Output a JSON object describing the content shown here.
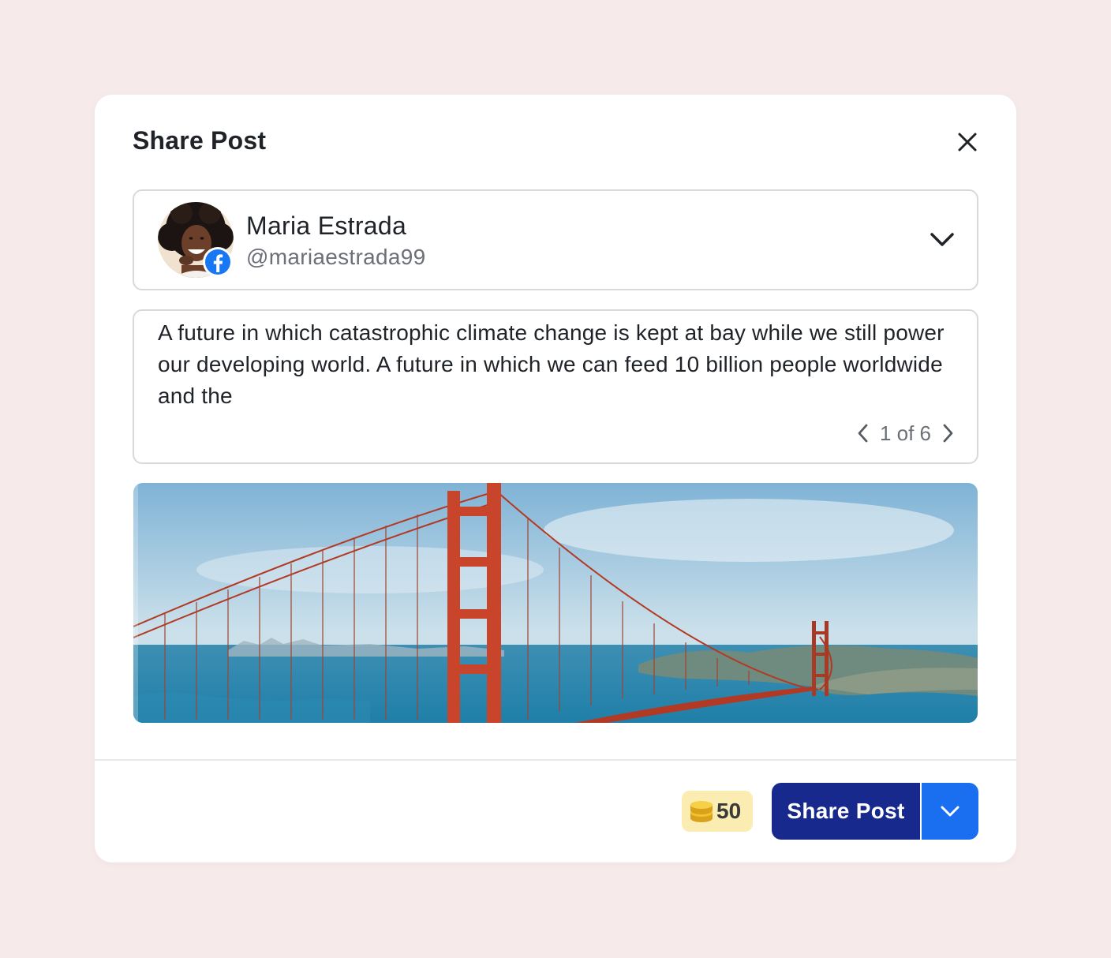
{
  "modal": {
    "title": "Share Post",
    "close_icon": "close-icon"
  },
  "account": {
    "name": "Maria Estrada",
    "handle": "@mariaestrada99",
    "network_icon": "facebook-icon",
    "dropdown_icon": "chevron-down-icon"
  },
  "post": {
    "text": "A future in which catastrophic climate change is kept at bay while we still power our developing world. A future in which we can feed 10 billion people worldwide and the",
    "pager": {
      "label": "1 of 6",
      "prev_icon": "chevron-left-icon",
      "next_icon": "chevron-right-icon"
    },
    "image": {
      "subject": "golden-gate-bridge-photo"
    }
  },
  "footer": {
    "credits": {
      "icon": "coins-icon",
      "value": "50"
    },
    "share_button_label": "Share Post",
    "share_dropdown_icon": "chevron-down-icon"
  },
  "colors": {
    "background": "#f6eaea",
    "primary_button": "#17298c",
    "dropdown_button": "#1a6ef0",
    "credits_badge": "#fbecb1",
    "facebook": "#1877f2"
  }
}
